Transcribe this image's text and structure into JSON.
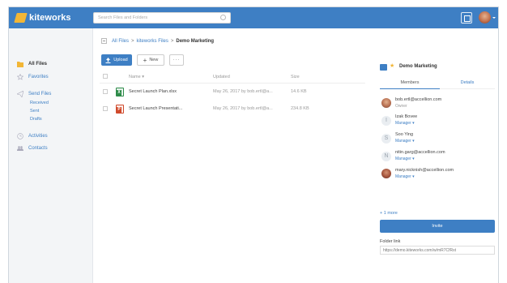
{
  "header": {
    "logo_text": "kiteworks",
    "search_placeholder": "Search Files and Folders"
  },
  "sidebar": {
    "items": [
      {
        "label": "All Files",
        "icon": "folder-icon"
      },
      {
        "label": "Favorites",
        "icon": "star-icon"
      },
      {
        "label": "Send Files",
        "icon": "send-icon"
      },
      {
        "label": "Activities",
        "icon": "clock-icon"
      },
      {
        "label": "Contacts",
        "icon": "contacts-icon"
      }
    ],
    "send_sub": [
      "Received",
      "Sent",
      "Drafts"
    ]
  },
  "breadcrumb": {
    "root": "All Files",
    "parent": "kiteworks Files",
    "current": "Demo Marketing",
    "sep": ">"
  },
  "toolbar": {
    "upload_label": "Upload",
    "new_label": "New",
    "more_label": "···"
  },
  "table": {
    "columns": [
      "Name",
      "Updated",
      "Size"
    ],
    "rows": [
      {
        "name": "Secret Launch Plan.xlsx",
        "updated": "May 26, 2017 by bob.ertl@a...",
        "size": "14.6 KB",
        "type": "xlsx-icon",
        "color": "#2e8b4a",
        "letter": "X"
      },
      {
        "name": "Secret Launch Presentati...",
        "updated": "May 26, 2017 by bob.ertl@a...",
        "size": "234.8 KB",
        "type": "pptx-icon",
        "color": "#d04a2c",
        "letter": "P"
      }
    ]
  },
  "panel": {
    "title": "Demo Marketing",
    "tabs": {
      "members": "Members",
      "details": "Details"
    },
    "members": [
      {
        "name": "bob.ertl@accellion.com",
        "role": "Owner",
        "avatar": "photo"
      },
      {
        "name": "Izak Bovee",
        "role": "Manager ▾",
        "avatar": "I"
      },
      {
        "name": "Soo Ying",
        "role": "Manager ▾",
        "avatar": "S"
      },
      {
        "name": "nitin.garg@accellion.com",
        "role": "Manager ▾",
        "avatar": "N"
      },
      {
        "name": "mary.nicknish@accellion.com",
        "role": "Manager ▾",
        "avatar": "photo"
      }
    ],
    "more_link": "+ 1 more",
    "invite_label": "Invite",
    "folder_link_label": "Folder link",
    "folder_link_value": "https://demo.kiteworks.com/w/mR7CfRst"
  },
  "colors": {
    "accent": "#3e7fc4",
    "star": "#f2b636"
  }
}
